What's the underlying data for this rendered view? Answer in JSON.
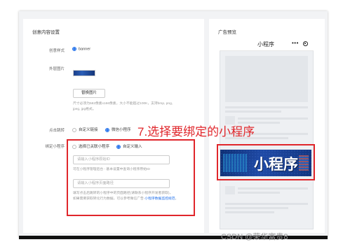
{
  "left_panel": {
    "section_title": "创意内容设置",
    "style_label": "创意样式",
    "style_value": "banner",
    "image_label": "外层图片",
    "replace_button": "替换图片",
    "image_hint_line1": "尺寸必须为582像素x166像素，大小不能超过100K，支持bmp, png,",
    "image_hint_line2": "jpeg, jpg格式。",
    "click_label": "点击跳转",
    "click_option1": "自定义链接",
    "click_option2": "微信小程序",
    "bind_label": "绑定小程序",
    "bind_option1": "选择已关联小程序",
    "bind_option2": "自定义输入",
    "appid_placeholder": "请输入小程序原始ID",
    "appid_hint": "可在小程序管理后台 - 基本设置中查询小程序原始ID",
    "path_placeholder": "请输入小程序页面路径",
    "path_hint_line1": "填写点击后跳转的小程序中的页面路径(请联系小程序开发者获取)，",
    "path_hint_line2_a": "如果需要获取转化行为数据，可以参考微信广告-",
    "path_hint_line2_link": "小程序数据监控规范",
    "path_hint_line2_b": "。"
  },
  "right_panel": {
    "section_title": "广告预览",
    "phone_title": "小程序",
    "phone_menu_icon": "more-dots-icon",
    "phone_record_icon": "record-circle-icon",
    "ad_text": "小程序"
  },
  "annotation": {
    "text": "7.选择要绑定的小程序"
  },
  "watermark": "CSDN @荣华富贵8",
  "colors": {
    "accent": "#1f6feb",
    "annotation_red": "#e0262b",
    "ad_blue": "#1f4aa6"
  }
}
